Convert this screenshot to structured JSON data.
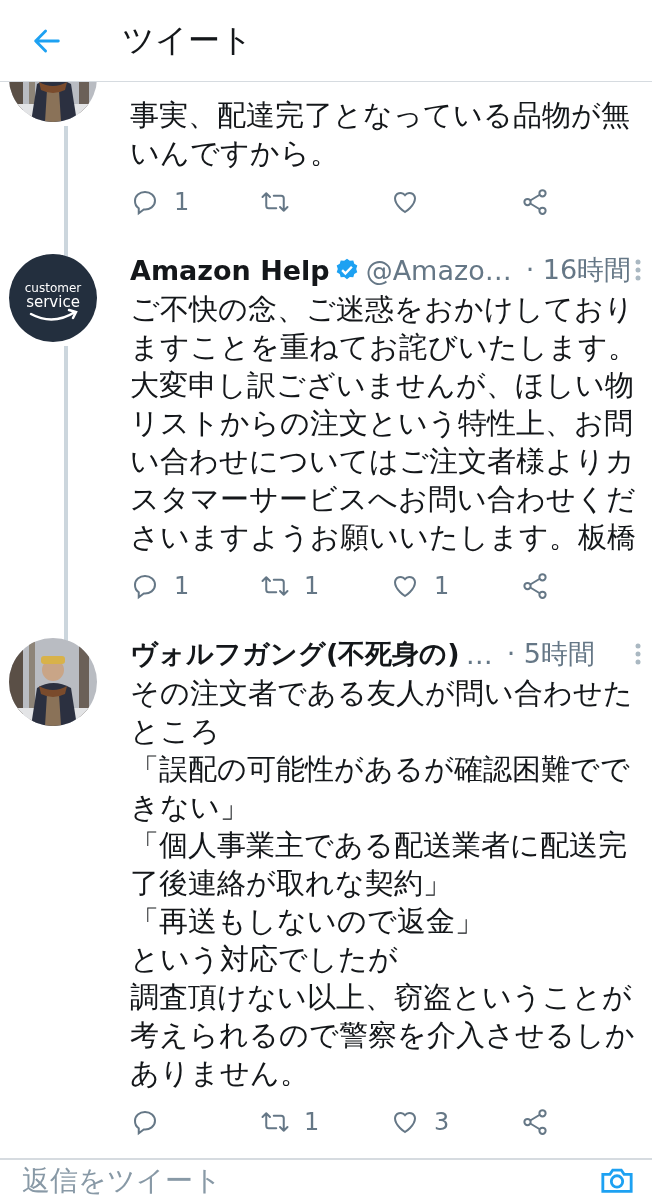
{
  "header": {
    "title": "ツイート"
  },
  "tweets": [
    {
      "avatar": {
        "kind": "picture"
      },
      "paragraphs": [
        "事実、配達完了となっている品物が無いんですから。"
      ],
      "actions": [
        {
          "kind": "reply",
          "count": "1"
        },
        {
          "kind": "retweet"
        },
        {
          "kind": "like"
        },
        {
          "kind": "share"
        }
      ]
    },
    {
      "avatar": {
        "kind": "logo",
        "lines": [
          "customer",
          "service"
        ]
      },
      "name": "Amazon Help",
      "verified": true,
      "handle": "@Amazo…",
      "time": "· 16時間",
      "paragraphs": [
        "ご不快の念、ご迷惑をおかけしておりますことを重ねてお詫びいたします。大変申し訳ございませんが、ほしい物リストからの注文という特性上、お問い合わせについてはご注文者様よりカスタマーサービスへお問い合わせくださいますようお願いいたします。板橋"
      ],
      "actions": [
        {
          "kind": "reply",
          "count": "1"
        },
        {
          "kind": "retweet",
          "count": "1"
        },
        {
          "kind": "like",
          "count": "1"
        },
        {
          "kind": "share"
        }
      ]
    },
    {
      "avatar": {
        "kind": "picture"
      },
      "name": "ヴォルフガング(不死身の)",
      "handle": "…",
      "time": "· 5時間",
      "paragraphs": [
        "その注文者である友人が問い合わせたところ",
        "「誤配の可能性があるが確認困難でできない」",
        "「個人事業主である配送業者に配送完了後連絡が取れな契約」",
        "「再送もしないので返金」",
        "という対応でしたが",
        "調査頂けない以上、窃盗ということが考えられるので警察を介入させるしかありません。"
      ],
      "actions": [
        {
          "kind": "reply"
        },
        {
          "kind": "retweet",
          "count": "1"
        },
        {
          "kind": "like",
          "count": "3"
        },
        {
          "kind": "share"
        }
      ]
    }
  ],
  "reply_bar": {
    "placeholder": "返信をツイート"
  }
}
